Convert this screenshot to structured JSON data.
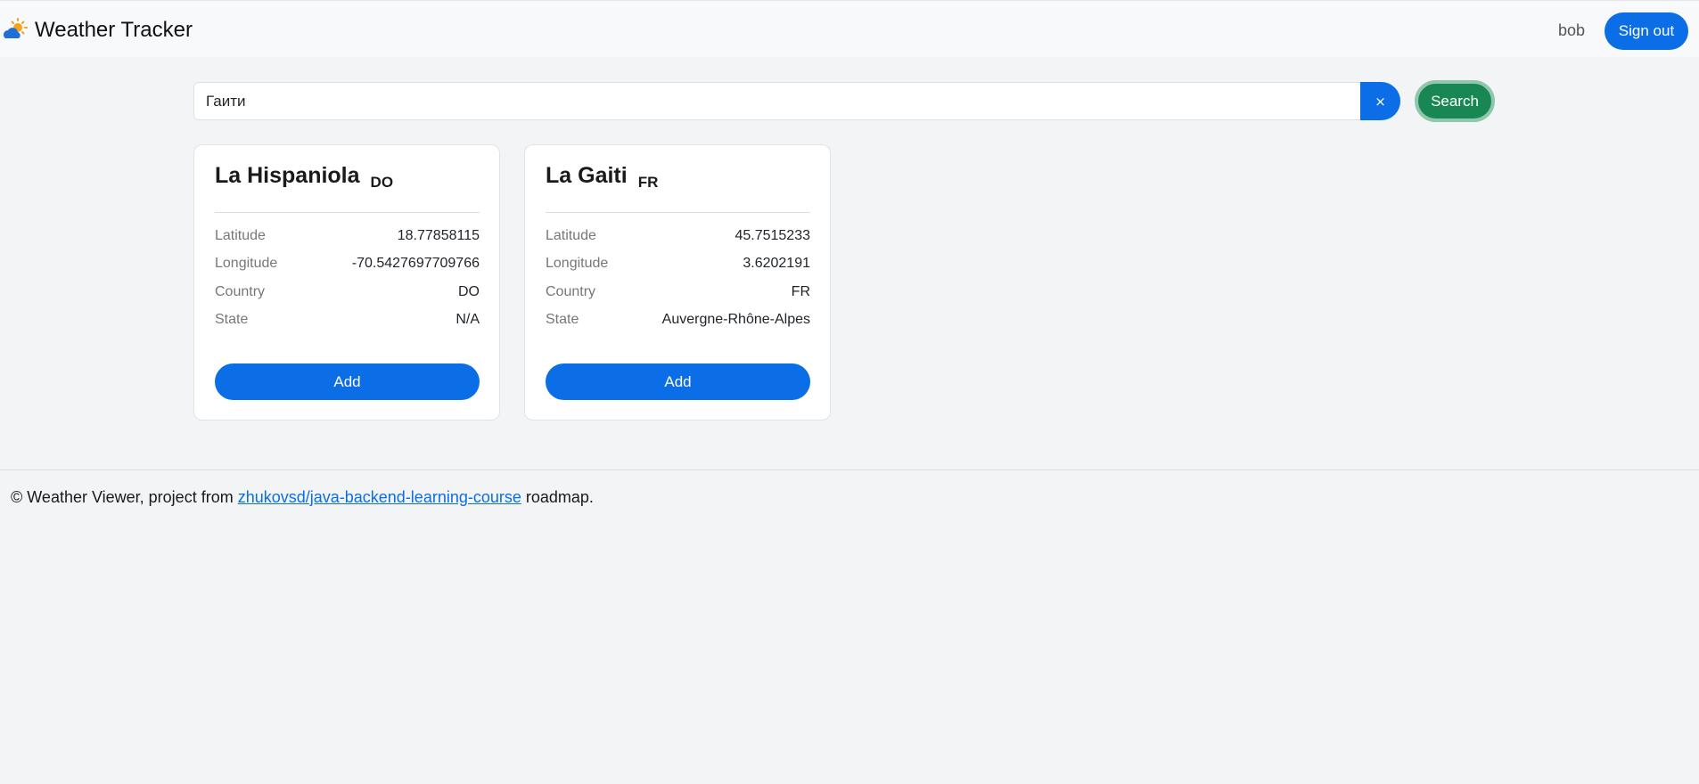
{
  "header": {
    "app_title": "Weather Tracker",
    "logo_icon": "sun-cloud-icon",
    "user_name": "bob",
    "signout_label": "Sign out"
  },
  "search": {
    "value": "Гаити",
    "clear_label": "×",
    "button_label": "Search"
  },
  "results": [
    {
      "name": "La Hispaniola",
      "code": "DO",
      "rows": [
        {
          "label": "Latitude",
          "value": "18.77858115"
        },
        {
          "label": "Longitude",
          "value": "-70.5427697709766"
        },
        {
          "label": "Country",
          "value": "DO"
        },
        {
          "label": "State",
          "value": "N/A"
        }
      ],
      "add_label": "Add"
    },
    {
      "name": "La Gaiti",
      "code": "FR",
      "rows": [
        {
          "label": "Latitude",
          "value": "45.7515233"
        },
        {
          "label": "Longitude",
          "value": "3.6202191"
        },
        {
          "label": "Country",
          "value": "FR"
        },
        {
          "label": "State",
          "value": "Auvergne-Rhône-Alpes"
        }
      ],
      "add_label": "Add"
    }
  ],
  "footer": {
    "prefix": "© Weather Viewer, project from ",
    "link_text": "zhukovsd/java-backend-learning-course",
    "suffix": " roadmap."
  },
  "colors": {
    "primary": "#0b6ee6",
    "success": "#198754",
    "background": "#f3f4f6"
  }
}
